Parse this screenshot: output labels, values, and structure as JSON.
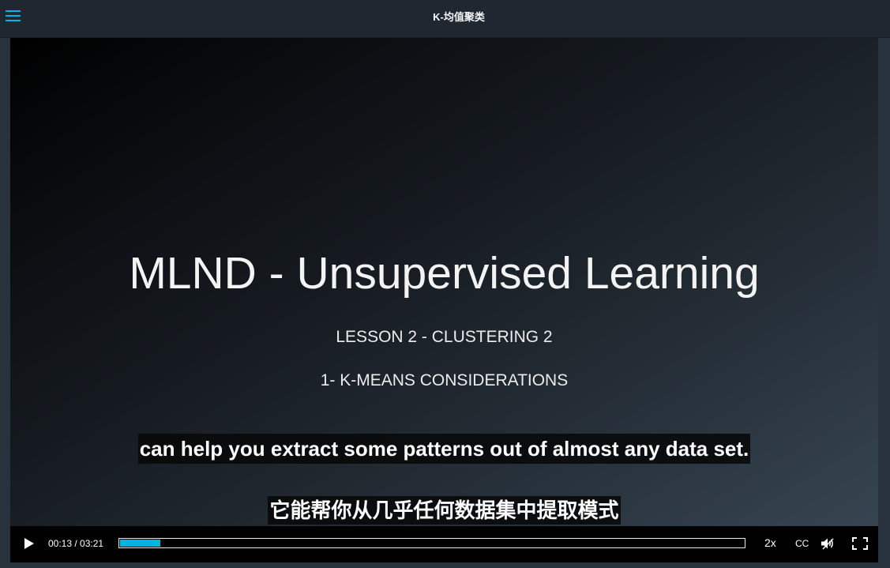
{
  "header": {
    "title": "K-均值聚类",
    "menu_icon": "hamburger-menu-icon"
  },
  "video": {
    "slide": {
      "title": "MLND - Unsupervised Learning",
      "lesson": "LESSON 2 - CLUSTERING 2",
      "section": "1- K-MEANS CONSIDERATIONS"
    },
    "subtitles": {
      "english": "can help you extract some patterns out of almost any data set.",
      "chinese": "它能帮你从几乎任何数据集中提取模式"
    },
    "controls": {
      "play_icon": "play-icon",
      "time_display": "00:13 / 03:21",
      "progress_fraction": 0.065,
      "speed_label": "2x",
      "captions_label": "CC",
      "volume_icon": "volume-icon",
      "fullscreen_icon": "fullscreen-icon"
    }
  },
  "colors": {
    "accent": "#02b3e4",
    "header_bg": "#1f2831",
    "controls_bg": "#000000"
  }
}
